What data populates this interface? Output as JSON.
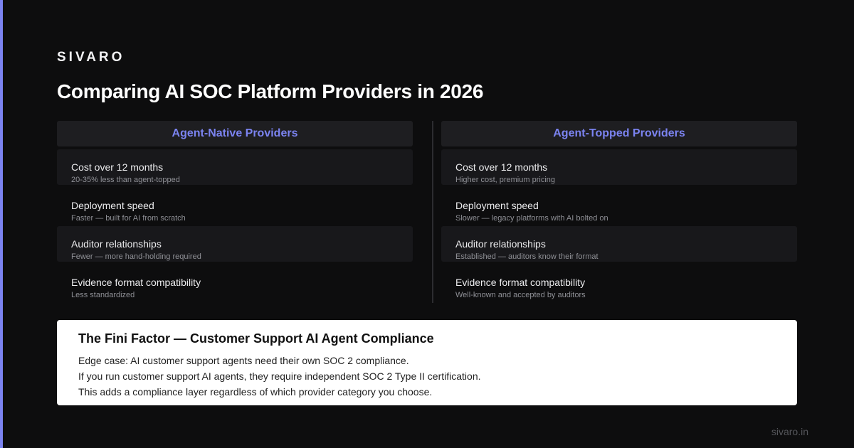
{
  "brand": "SIVARO",
  "title": "Comparing AI SOC Platform Providers in 2026",
  "columns": [
    {
      "header": "Agent-Native Providers",
      "rows": [
        {
          "label": "Cost over 12 months",
          "desc": "20-35% less than agent-topped"
        },
        {
          "label": "Deployment speed",
          "desc": "Faster — built for AI from scratch"
        },
        {
          "label": "Auditor relationships",
          "desc": "Fewer — more hand-holding required"
        },
        {
          "label": "Evidence format compatibility",
          "desc": "Less standardized"
        }
      ]
    },
    {
      "header": "Agent-Topped Providers",
      "rows": [
        {
          "label": "Cost over 12 months",
          "desc": "Higher cost, premium pricing"
        },
        {
          "label": "Deployment speed",
          "desc": "Slower — legacy platforms with AI bolted on"
        },
        {
          "label": "Auditor relationships",
          "desc": "Established — auditors know their format"
        },
        {
          "label": "Evidence format compatibility",
          "desc": "Well-known and accepted by auditors"
        }
      ]
    }
  ],
  "note": {
    "title": "The Fini Factor — Customer Support AI Agent Compliance",
    "lines": [
      "Edge case: AI customer support agents need their own SOC 2 compliance.",
      "If you run customer support AI agents, they require independent SOC 2 Type II certification.",
      "This adds a compliance layer regardless of which provider category you choose."
    ]
  },
  "footer": {
    "url": "sivaro.in"
  },
  "colors": {
    "accent": "#7b83f0",
    "background": "#0d0d0e",
    "card": "#18181b",
    "note_bg": "#ffffff"
  }
}
